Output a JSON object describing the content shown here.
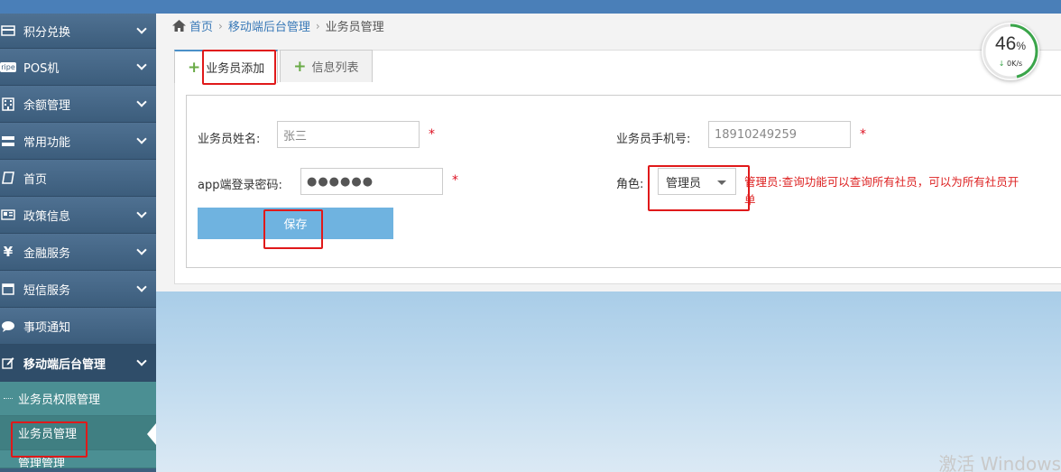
{
  "sidebar": {
    "items": [
      {
        "label": "积分兑换",
        "icon": "credit-card-icon"
      },
      {
        "label": "POS机",
        "icon": "pos-icon",
        "badge": "ripe"
      },
      {
        "label": "余额管理",
        "icon": "building-icon"
      },
      {
        "label": "常用功能",
        "icon": "server-icon"
      },
      {
        "label": "首页",
        "icon": "book-icon"
      },
      {
        "label": "政策信息",
        "icon": "id-card-icon"
      },
      {
        "label": "金融服务",
        "icon": "yen-icon"
      },
      {
        "label": "短信服务",
        "icon": "inbox-icon"
      },
      {
        "label": "事项通知",
        "icon": "chat-icon"
      },
      {
        "label": "移动端后台管理",
        "icon": "edit-icon"
      }
    ],
    "sub_items": [
      {
        "label": "业务员权限管理"
      },
      {
        "label": "业务员管理"
      },
      {
        "label": "管理管理"
      }
    ]
  },
  "breadcrumb": {
    "home": "首页",
    "level1": "移动端后台管理",
    "current": "业务员管理"
  },
  "tabs": [
    {
      "label": "业务员添加"
    },
    {
      "label": "信息列表"
    }
  ],
  "form": {
    "name_label": "业务员姓名:",
    "name_value": "张三",
    "phone_label": "业务员手机号:",
    "phone_value": "18910249259",
    "password_label": "app端登录密码:",
    "password_value": "●●●●●●",
    "role_label": "角色:",
    "role_value": "管理员",
    "required_mark": "*",
    "role_note": "管理员:查询功能可以查询所有社员，可以为所有社员开单",
    "save_label": "保存"
  },
  "speed_widget": {
    "percent": "46",
    "percent_unit": "%",
    "rate": "0K/s",
    "progress": 0.46
  },
  "watermark": "激活 Windows",
  "colors": {
    "sidebar": "#3d5f7e",
    "submenu": "#4b8f93",
    "accent": "#4a90c8",
    "save_button": "#6fb3e0",
    "required": "#dd1122",
    "highlight_box": "#e0191a",
    "speed_ring": "#3aa54a"
  }
}
